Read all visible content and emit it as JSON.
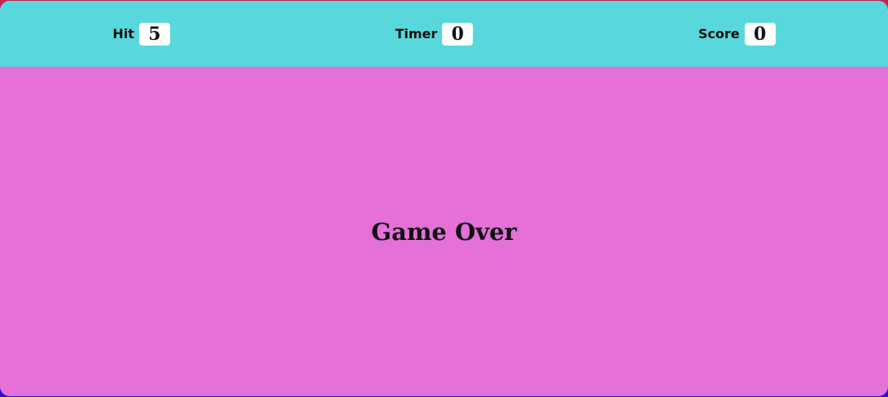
{
  "hud": {
    "hit": {
      "label": "Hit",
      "value": "5"
    },
    "timer": {
      "label": "Timer",
      "value": "0"
    },
    "score": {
      "label": "Score",
      "value": "0"
    }
  },
  "main": {
    "message": "Game Over"
  },
  "colors": {
    "hud_background": "#58d8dc",
    "play_area_background": "#e470d8",
    "value_box": "#ffffff"
  }
}
